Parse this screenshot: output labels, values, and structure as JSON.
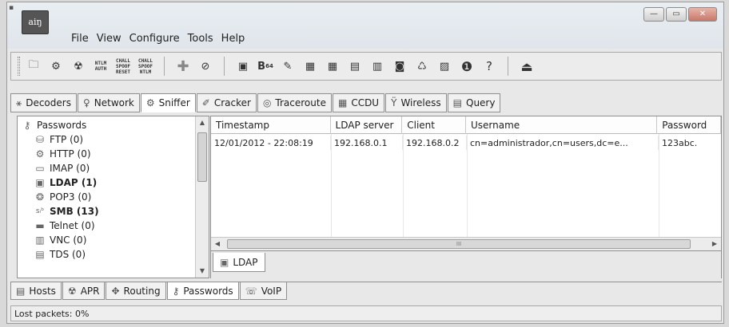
{
  "app": {
    "icon_text": "aiŋ"
  },
  "menu": [
    "File",
    "View",
    "Configure",
    "Tools",
    "Help"
  ],
  "toolbar": {
    "ntlm_auth": "NTLM AUTH",
    "chall_spoof_reset": "CHALL SPOOF RESET",
    "chall_spoof_ntlm": "CHALL SPOOF NTLM",
    "base64_sub": "64"
  },
  "top_tabs": [
    {
      "label": "Decoders",
      "icon": "decoders-icon"
    },
    {
      "label": "Network",
      "icon": "network-icon"
    },
    {
      "label": "Sniffer",
      "icon": "sniffer-icon"
    },
    {
      "label": "Cracker",
      "icon": "cracker-icon"
    },
    {
      "label": "Traceroute",
      "icon": "traceroute-icon"
    },
    {
      "label": "CCDU",
      "icon": "ccdu-icon"
    },
    {
      "label": "Wireless",
      "icon": "wireless-icon"
    },
    {
      "label": "Query",
      "icon": "query-icon"
    }
  ],
  "tree": {
    "root": "Passwords",
    "items": [
      {
        "label": "FTP (0)",
        "bold": false
      },
      {
        "label": "HTTP (0)",
        "bold": false
      },
      {
        "label": "IMAP (0)",
        "bold": false
      },
      {
        "label": "LDAP (1)",
        "bold": true
      },
      {
        "label": "POP3 (0)",
        "bold": false
      },
      {
        "label": "SMB (13)",
        "bold": true
      },
      {
        "label": "Telnet (0)",
        "bold": false
      },
      {
        "label": "VNC (0)",
        "bold": false
      },
      {
        "label": "TDS (0)",
        "bold": false
      }
    ]
  },
  "table": {
    "columns": [
      "Timestamp",
      "LDAP server",
      "Client",
      "Username",
      "Password"
    ],
    "rows": [
      [
        "12/01/2012 - 22:08:19",
        "192.168.0.1",
        "192.168.0.2",
        "cn=administrador,cn=users,dc=e...",
        "123abc."
      ]
    ]
  },
  "scroll": {
    "thumb_label": "III"
  },
  "sub_tab": "LDAP",
  "bottom_tabs": [
    {
      "label": "Hosts"
    },
    {
      "label": "APR"
    },
    {
      "label": "Routing"
    },
    {
      "label": "Passwords"
    },
    {
      "label": "VoIP"
    }
  ],
  "status": {
    "lost_packets": "Lost packets:  0%"
  }
}
